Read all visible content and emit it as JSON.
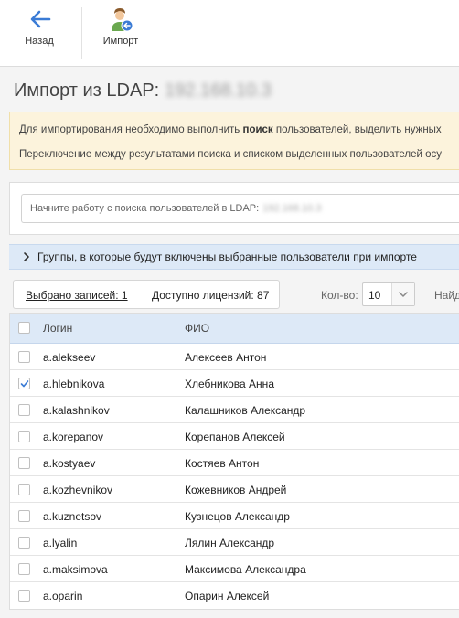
{
  "toolbar": {
    "back_label": "Назад",
    "import_label": "Импорт"
  },
  "page": {
    "title": "Импорт из LDAP:",
    "host_blurred": "192.168.10.3"
  },
  "notice": {
    "line1_prefix": "Для импортирования необходимо выполнить ",
    "line1_bold": "поиск",
    "line1_suffix": " пользователей, выделить нужных",
    "line2": "Переключение между результатами поиска и списком выделенных пользователей осу"
  },
  "search": {
    "placeholder": "Начните работу с поиска пользователей в LDAP:",
    "host_blurred": "192.168.10.3"
  },
  "groups_bar": {
    "label": "Группы, в которые будут включены выбранные пользователи при импорте"
  },
  "selection": {
    "selected_label": "Выбрано записей: 1",
    "licenses_label": "Доступно лицензий: 87"
  },
  "page_size": {
    "label": "Кол-во:",
    "value": "10"
  },
  "find": {
    "label": "Найд"
  },
  "table": {
    "columns": [
      "Логин",
      "ФИО"
    ],
    "rows": [
      {
        "login": "a.alekseev",
        "name": "Алексеев Антон",
        "checked": false
      },
      {
        "login": "a.hlebnikova",
        "name": "Хлебникова Анна",
        "checked": true
      },
      {
        "login": "a.kalashnikov",
        "name": "Калашников Александр",
        "checked": false
      },
      {
        "login": "a.korepanov",
        "name": "Корепанов Алексей",
        "checked": false
      },
      {
        "login": "a.kostyaev",
        "name": "Костяев Антон",
        "checked": false
      },
      {
        "login": "a.kozhevnikov",
        "name": "Кожевников Андрей",
        "checked": false
      },
      {
        "login": "a.kuznetsov",
        "name": "Кузнецов Александр",
        "checked": false
      },
      {
        "login": "a.lyalin",
        "name": "Лялин Александр",
        "checked": false
      },
      {
        "login": "a.maksimova",
        "name": "Максимова Александра",
        "checked": false
      },
      {
        "login": "a.oparin",
        "name": "Опарин Алексей",
        "checked": false
      }
    ]
  },
  "colors": {
    "accent": "#3a7bd5",
    "header_bg": "#dde9f7",
    "notice_bg": "#fcf3dc"
  }
}
